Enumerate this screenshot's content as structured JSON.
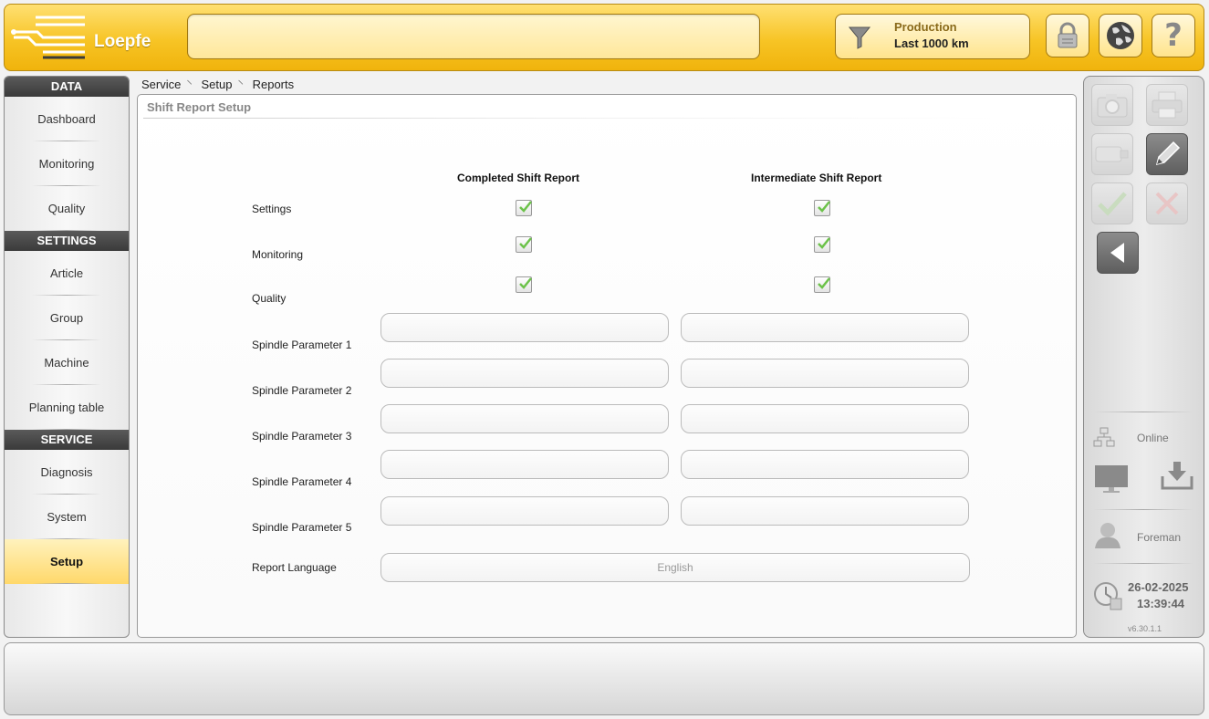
{
  "header": {
    "logo_text": "Loepfe",
    "filter": {
      "line1": "Production",
      "line2": "Last 1000 km"
    },
    "buttons": [
      "lock-icon",
      "globe-icon",
      "help-icon"
    ]
  },
  "breadcrumb": [
    "Service",
    "Setup",
    "Reports"
  ],
  "sidebar": {
    "sections": [
      {
        "title": "DATA",
        "items": [
          "Dashboard",
          "Monitoring",
          "Quality"
        ]
      },
      {
        "title": "SETTINGS",
        "items": [
          "Article",
          "Group",
          "Machine",
          "Planning table"
        ]
      },
      {
        "title": "SERVICE",
        "items": [
          "Diagnosis",
          "System",
          "Setup"
        ]
      }
    ],
    "active": "Setup"
  },
  "main": {
    "title": "Shift Report Setup",
    "col_completed": "Completed Shift Report",
    "col_intermediate": "Intermediate Shift Report",
    "check_rows": [
      {
        "label": "Settings",
        "completed": true,
        "intermediate": true
      },
      {
        "label": "Monitoring",
        "completed": true,
        "intermediate": true
      },
      {
        "label": "Quality",
        "completed": true,
        "intermediate": true
      }
    ],
    "param_rows": [
      {
        "label": "Spindle Parameter 1",
        "completed": "",
        "intermediate": ""
      },
      {
        "label": "Spindle Parameter 2",
        "completed": "",
        "intermediate": ""
      },
      {
        "label": "Spindle Parameter 3",
        "completed": "",
        "intermediate": ""
      },
      {
        "label": "Spindle Parameter 4",
        "completed": "",
        "intermediate": ""
      },
      {
        "label": "Spindle Parameter 5",
        "completed": "",
        "intermediate": ""
      }
    ],
    "language_label": "Report Language",
    "language_value": "English"
  },
  "right": {
    "status": "Online",
    "user": "Foreman",
    "date": "26-02-2025",
    "time": "13:39:44",
    "version": "v6.30.1.1"
  },
  "colors": {
    "accent": "#f7c425",
    "active_nav": "#ffd86a",
    "check": "#6cc24a"
  }
}
